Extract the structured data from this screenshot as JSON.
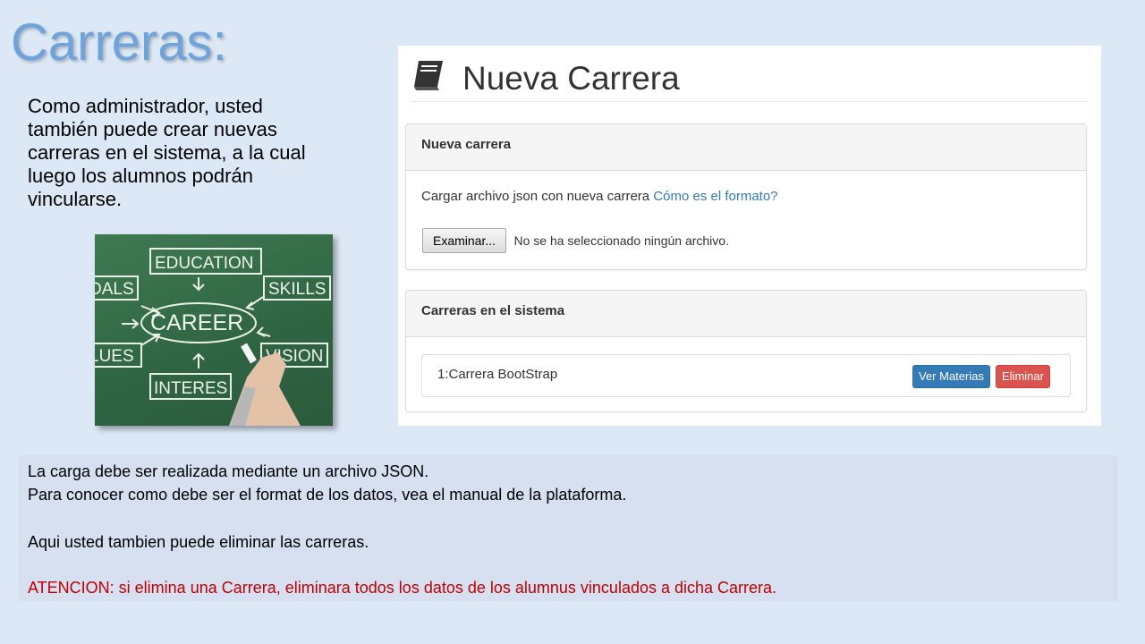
{
  "slide": {
    "title": "Carreras:",
    "intro": "Como administrador, usted también puede crear nuevas carreras en el sistema, a la cual luego los alumnos podrán vincularse."
  },
  "photo": {
    "words": [
      "EDUCATION",
      "DALS",
      "SKILLS",
      "CAREER",
      "LUES",
      "VISION",
      "INTERES"
    ]
  },
  "app": {
    "page_title": "Nueva Carrera",
    "new_card": {
      "heading": "Nueva carrera",
      "upload_text": "Cargar archivo json con nueva carrera",
      "format_link": "Cómo es el formato?",
      "browse_button": "Examinar...",
      "no_file_text": "No se ha seleccionado ningún archivo."
    },
    "list_card": {
      "heading": "Carreras en el sistema",
      "items": [
        {
          "name": "1:Carrera BootStrap",
          "view_label": "Ver Materias",
          "delete_label": "Eliminar"
        }
      ]
    }
  },
  "notes": {
    "line1": "La carga debe ser realizada mediante un archivo JSON.",
    "line2": "Para conocer como debe ser el format de los datos, vea el manual de la plataforma.",
    "line3": "Aqui usted tambien puede eliminar las carreras.",
    "warning": "ATENCION: si elimina una Carrera, eliminara todos los datos de los alumnus vinculados a dicha Carrera."
  },
  "colors": {
    "title": "#6fa3dc",
    "link": "#337ab7",
    "primary_button": "#337ab7",
    "danger_button": "#d9534f",
    "warning_text": "#c00000"
  }
}
